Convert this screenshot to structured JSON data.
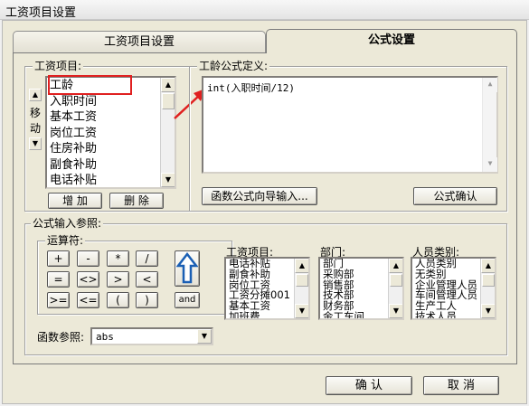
{
  "window": {
    "title": "工资项目设置"
  },
  "tabs": [
    {
      "label": "工资项目设置"
    },
    {
      "label": "公式设置"
    }
  ],
  "salary_items": {
    "label": "工资项目:",
    "items": [
      "工龄",
      "入职时间",
      "基本工资",
      "岗位工资",
      "住房补助",
      "副食补助",
      "电话补贴"
    ],
    "move_label": [
      "移",
      "动"
    ],
    "add_button": "增 加",
    "delete_button": "删 除"
  },
  "formula": {
    "label": "工龄公式定义:",
    "value": "int(入职时间/12)",
    "wizard_button": "函数公式向导输入...",
    "confirm_button": "公式确认"
  },
  "params": {
    "label": "公式输入参照:",
    "operators_label": "运算符:",
    "operators": [
      "+",
      "-",
      "*",
      "/",
      "=",
      "<>",
      ">",
      "<",
      ">=",
      "<=",
      "(",
      ")",
      "and"
    ],
    "items_label": "工资项目:",
    "items": [
      "电话补贴",
      "副食补助",
      "岗位工资",
      "工资分摊001",
      "基本工资",
      "加班费"
    ],
    "department_label": "部门:",
    "departments": [
      "部门",
      "采购部",
      "销售部",
      "技术部",
      "财务部",
      "金工车间"
    ],
    "category_label": "人员类别:",
    "categories": [
      "人员类别",
      "无类别",
      "企业管理人员",
      "车间管理人员",
      "生产工人",
      "技术人员"
    ],
    "function_label": "函数参照:",
    "function_value": "abs"
  },
  "dialog": {
    "ok_button": "确 认",
    "cancel_button": "取 消"
  },
  "colors": {
    "highlight": "#e02020"
  }
}
